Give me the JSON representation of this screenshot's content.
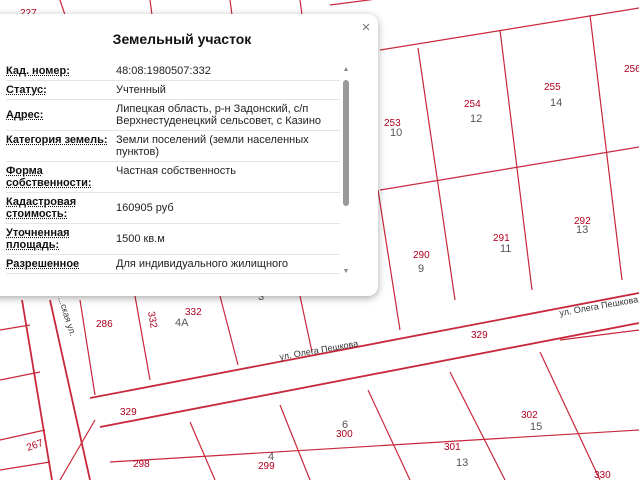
{
  "popup": {
    "title": "Земельный участок",
    "close_icon": "×",
    "rows": [
      {
        "label": "Кад. номер:",
        "value": "48:08:1980507:332"
      },
      {
        "label": "Статус:",
        "value": "Учтенный"
      },
      {
        "label": "Адрес:",
        "value": "Липецкая область, р-н Задонский, с/п Верхнестуденецкий сельсовет, с Казино"
      },
      {
        "label": "Категория земель:",
        "value": "Земли поселений (земли населенных пунктов)"
      },
      {
        "label": "Форма собственности:",
        "value": "Частная собственность"
      },
      {
        "label": "Кадастровая стоимость:",
        "value": "160905 руб"
      },
      {
        "label": "Уточненная площадь:",
        "value": "1500 кв.м"
      },
      {
        "label": "Разрешенное",
        "value": "Для индивидуального жилищного"
      }
    ]
  },
  "map": {
    "plot_color": "#b0001e",
    "line_color": "#c8283c",
    "plot_numbers": [
      "227",
      "253",
      "254",
      "255",
      "256",
      "290",
      "291",
      "292",
      "286",
      "332",
      "332",
      "329",
      "329",
      "300",
      "301",
      "302",
      "298",
      "299",
      "267",
      "330"
    ],
    "house_numbers": [
      "10",
      "12",
      "14",
      "9",
      "11",
      "13",
      "4А",
      "6",
      "13",
      "15",
      "4",
      "3"
    ],
    "streets": [
      "ул. Олега Пешкова",
      "ул. Олега Пешкова",
      "...ская ул."
    ]
  }
}
